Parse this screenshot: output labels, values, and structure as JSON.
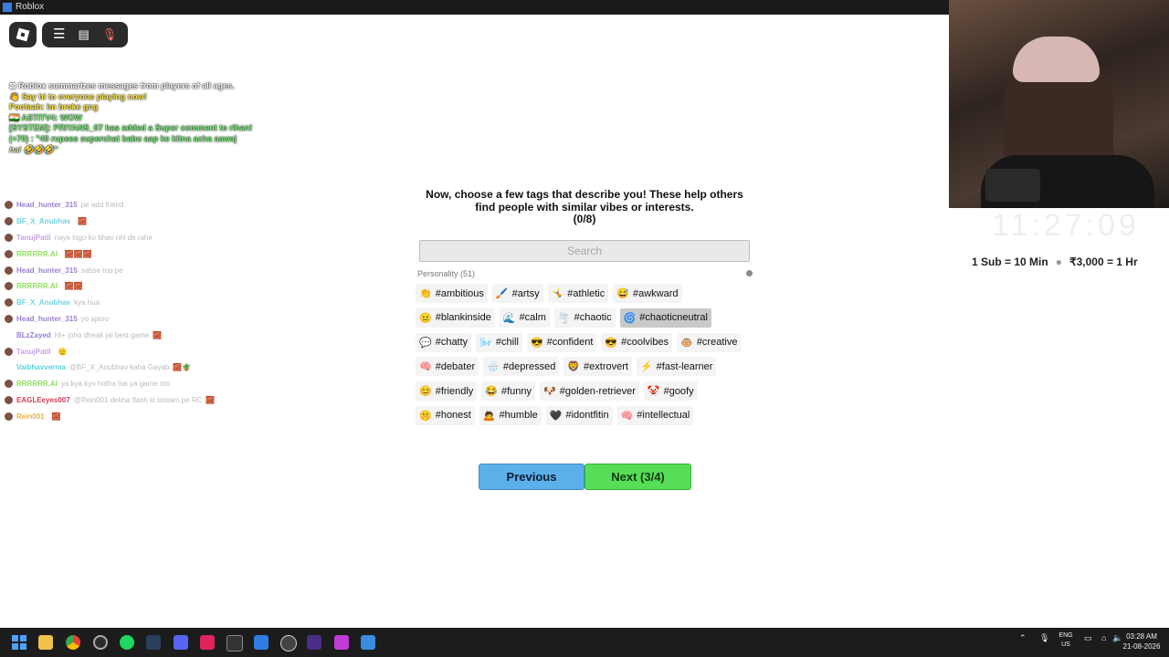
{
  "window": {
    "title": "Roblox"
  },
  "roblox_topbar": {
    "menu_icon": "hamburger-icon",
    "chat_icon": "chat-icon",
    "mic_icon": "mic-muted-icon"
  },
  "system_messages": [
    {
      "text": "⊠ Roblox summarizes messages from players of all ages.",
      "style": ""
    },
    {
      "text": "👋 Say hi to everyone playing now!",
      "style": "yellow"
    },
    {
      "text": "Pootaah: im broke gng",
      "style": "yellow"
    },
    {
      "text": "🇮🇳 ASTITV4: WOW",
      "style": "green"
    },
    {
      "text": "[SYSTEM]: PRIYANS_07 has added a Super comment to rihan! (+70) : \"40 rupees superchat  babu aap ke kitna acha aawaj",
      "style": "green"
    },
    {
      "text": "hai 🤣🤣🤣\"",
      "style": "italic"
    }
  ],
  "chat": [
    {
      "user": "Head_hunter_315",
      "msg": "pe add friend",
      "color": "#9b7fd4",
      "emoji": ""
    },
    {
      "user": "BF_X_Anubhav",
      "msg": "",
      "color": "#6fd3e0",
      "emoji": "🧱"
    },
    {
      "user": "TanujPatil",
      "msg": "naye logo ko bhav nhi de rahe",
      "color": "#c8a0e8",
      "emoji": ""
    },
    {
      "user": "RRRRRR.AI",
      "msg": "",
      "color": "#8de05c",
      "emoji": "🧱🧱🧱"
    },
    {
      "user": "Head_hunter_315",
      "msg": "sabse top pe",
      "color": "#9b7fd4",
      "emoji": ""
    },
    {
      "user": "RRRRRR.AI",
      "msg": "",
      "color": "#8de05c",
      "emoji": "🧱🧱"
    },
    {
      "user": "BF_X_Anubhav",
      "msg": "kya hua",
      "color": "#6fd3e0",
      "emoji": ""
    },
    {
      "user": "Head_hunter_315",
      "msg": "yo ajaoo",
      "color": "#9b7fd4",
      "emoji": ""
    },
    {
      "user": "BLzZayed",
      "msg": "Hi+ joho dheak jai best game",
      "color": "#9b7fd4",
      "emoji": "🧱"
    },
    {
      "user": "TanujPatil",
      "msg": "",
      "color": "#c8a0e8",
      "emoji": "🫡"
    },
    {
      "user": "Vaibhavverma",
      "msg": "@BF_X_Anubhav kaha Gayab",
      "color": "#5ad1d9",
      "emoji": "🧱🪴"
    },
    {
      "user": "RRRRRR.AI",
      "msg": "ya kya kyo hotha hai ya game mo",
      "color": "#8de05c",
      "emoji": ""
    },
    {
      "user": "EAGLEeyes007",
      "msg": "@Rein001 dekha flash ki stream pe RC",
      "color": "#d23c5a",
      "emoji": "🧱"
    },
    {
      "user": "Rein001",
      "msg": "",
      "color": "#e3b24a",
      "emoji": "🧱"
    }
  ],
  "dialog": {
    "prompt": "Now, choose a few tags that describe you! These help others find people with similar vibes or interests.",
    "counter": "(0/8)",
    "search_placeholder": "Search",
    "category": "Personality (51)",
    "tag_rows": [
      [
        {
          "icon": "👏",
          "label": "#ambitious"
        },
        {
          "icon": "🖌️",
          "label": "#artsy"
        },
        {
          "icon": "🤸",
          "label": "#athletic"
        },
        {
          "icon": "😅",
          "label": "#awkward"
        }
      ],
      [
        {
          "icon": "😐",
          "label": "#blankinside"
        },
        {
          "icon": "🌊",
          "label": "#calm"
        },
        {
          "icon": "🌪️",
          "label": "#chaotic"
        },
        {
          "icon": "🌀",
          "label": "#chaoticneutral",
          "selected": true
        }
      ],
      [
        {
          "icon": "💬",
          "label": "#chatty"
        },
        {
          "icon": "🌬️",
          "label": "#chill"
        },
        {
          "icon": "😎",
          "label": "#confident"
        },
        {
          "icon": "😎",
          "label": "#coolvibes"
        },
        {
          "icon": "🐵",
          "label": "#creative"
        }
      ],
      [
        {
          "icon": "🧠",
          "label": "#debater"
        },
        {
          "icon": "🌧️",
          "label": "#depressed"
        },
        {
          "icon": "🦁",
          "label": "#extrovert"
        },
        {
          "icon": "⚡",
          "label": "#fast-learner"
        }
      ],
      [
        {
          "icon": "😊",
          "label": "#friendly"
        },
        {
          "icon": "😂",
          "label": "#funny"
        },
        {
          "icon": "🐶",
          "label": "#golden-retriever"
        },
        {
          "icon": "🤡",
          "label": "#goofy"
        }
      ],
      [
        {
          "icon": "🤫",
          "label": "#honest"
        },
        {
          "icon": "🙇",
          "label": "#humble"
        },
        {
          "icon": "🖤",
          "label": "#idontfitin"
        },
        {
          "icon": "🧠",
          "label": "#intellectual"
        }
      ]
    ],
    "previous_label": "Previous",
    "next_label": "Next (3/4)"
  },
  "stream_overlay": {
    "clock_ghost": "11:27:09",
    "sub_rate": "1 Sub = 10 Min",
    "donation_rate": "₹3,000 = 1 Hr"
  },
  "taskbar": {
    "apps": [
      "windows-start-icon",
      "file-explorer-icon",
      "chrome-icon",
      "obs-icon",
      "spotify-icon",
      "steam-icon",
      "discord-icon",
      "adobe-icon",
      "epic-games-icon",
      "arc-icon",
      "chatgpt-icon",
      "vs-icon",
      "screen-capture-icon",
      "roblox-icon"
    ],
    "lang_1": "ENG",
    "lang_2": "US",
    "time": "03:28 AM",
    "date": "21-08-2026"
  },
  "colors": {
    "previous_button": "#5cb0ea",
    "next_button": "#58dd58",
    "taskbar": "#1c1c1c"
  }
}
